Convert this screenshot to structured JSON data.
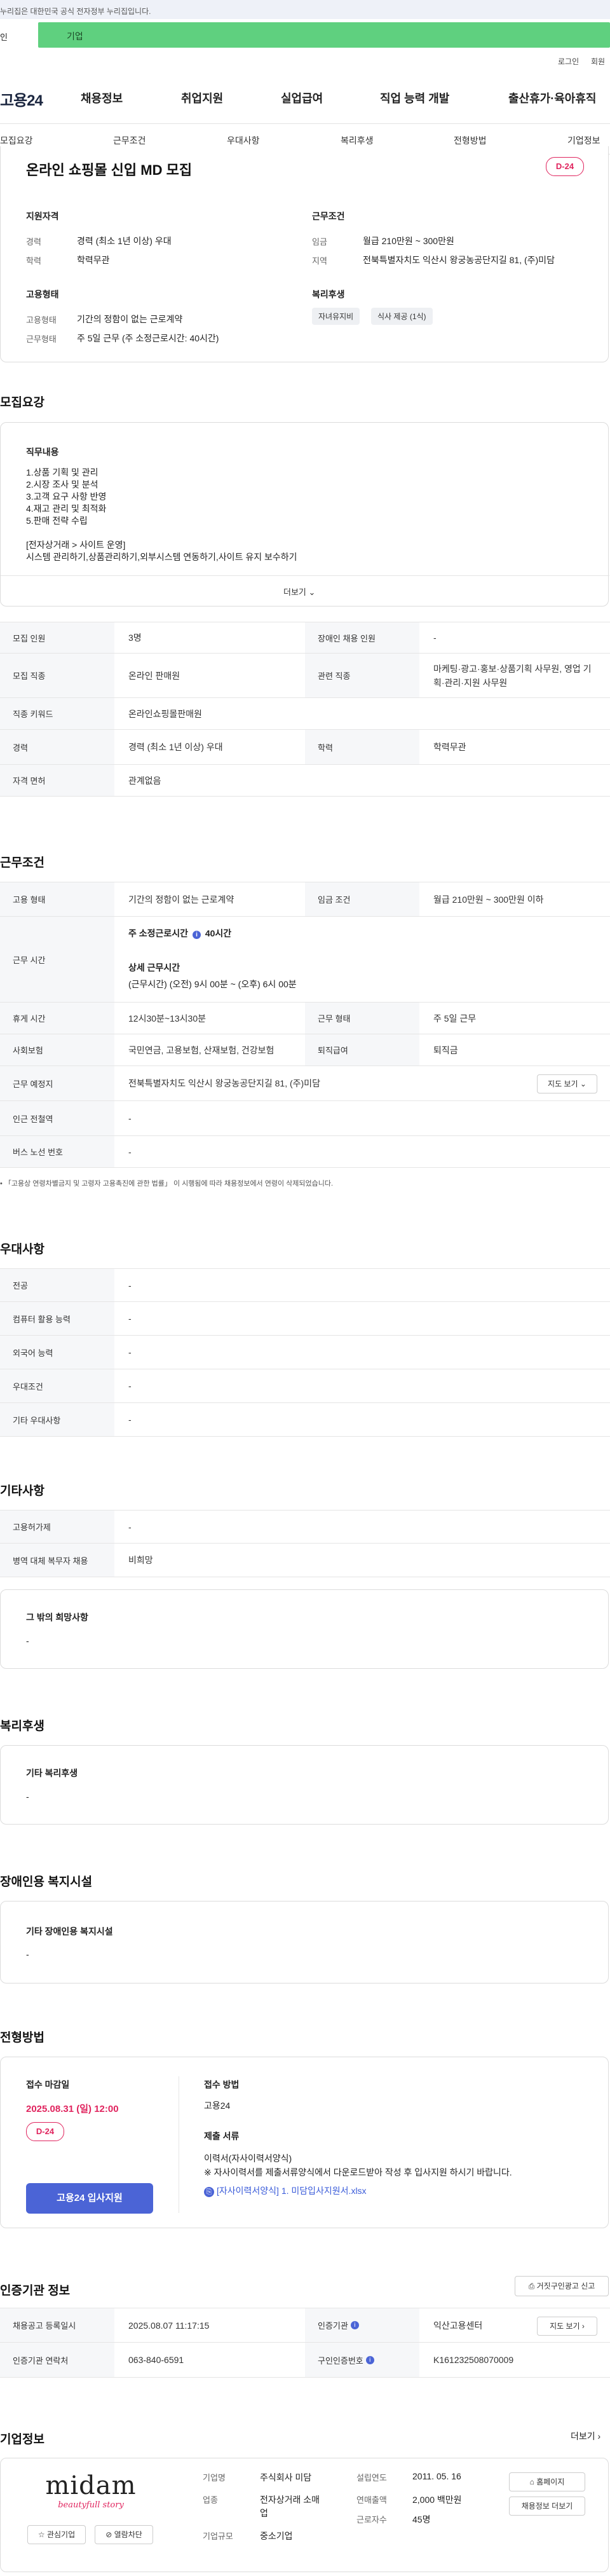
{
  "topbar": {
    "notice": "누리집은 대한민국 공식 전자정부 누리집입니다."
  },
  "env": {
    "left": "인",
    "right": "기업"
  },
  "util": {
    "login": "로그인",
    "join": "회원"
  },
  "logo": "고용24",
  "gnb": [
    "채용정보",
    "취업지원",
    "실업급여",
    "직업 능력 개발",
    "출산휴가·육아휴직"
  ],
  "subnav": [
    "모집요강",
    "근무조건",
    "우대사항",
    "복리후생",
    "전형방법",
    "기업정보"
  ],
  "summary": {
    "title": "온라인 쇼핑몰 신입 MD 모집",
    "dday": "D-24",
    "qual_title": "지원자격",
    "career_label": "경력",
    "career": "경력 (최소 1년 이상) 우대",
    "edu_label": "학력",
    "edu": "학력무관",
    "cond_title": "근무조건",
    "wage_label": "임금",
    "wage": "월급 210만원 ~ 300만원",
    "region_label": "지역",
    "region": "전북특별자치도 익산시 왕궁농공단지길 81, (주)미담",
    "emp_title": "고용형태",
    "emptype_label": "고용형태",
    "emptype": "기간의 정함이 없는 근로계약",
    "worktype_label": "근무형태",
    "worktype": "주 5일 근무 (주 소정근로시간: 40시간)",
    "welfare_title": "복리후생",
    "chips": [
      "자녀유지비",
      "식사 제공 (1식)"
    ]
  },
  "recruit": {
    "section_title": "모집요강",
    "duty_title": "직무내용",
    "duty_lines": [
      "1.상품 기획 및 관리",
      "2.시장 조사 및 분석",
      "3.고객 요구 사항 반영",
      "4.재고 관리 및 최적화",
      "5.판매 전략 수립"
    ],
    "duty_extra1": "[전자상거래 > 사이트 운영]",
    "duty_extra2": "시스템 관리하기,상품관리하기,외부시스템 연동하기,사이트 유지 보수하기",
    "more": "더보기",
    "rows": [
      {
        "l1": "모집 인원",
        "v1": "3명",
        "l2": "장애인 채용 인원",
        "v2": "-"
      },
      {
        "l1": "모집 직종",
        "v1": "온라인 판매원",
        "l2": "관련 직종",
        "v2a": "마케팅·광고·홍보·상품기획 사무원, 영업 기",
        "v2b": "획·관리·지원 사무원"
      },
      {
        "l1": "직종 키워드",
        "v1": "온라인쇼핑몰판매원"
      },
      {
        "l1": "경력",
        "v1": "경력 (최소 1년 이상) 우대",
        "l2": "학력",
        "v2": "학력무관"
      },
      {
        "l1": "자격 면허",
        "v1": "관계없음"
      }
    ]
  },
  "work": {
    "section_title": "근무조건",
    "emp_label": "고용 형태",
    "emp": "기간의 정함이 없는 근로계약",
    "wage_label": "임금 조건",
    "wage": "월급 210만원 ~ 300만원 이하",
    "hours_label": "근무 시간",
    "hours_week": "주 소정근로시간",
    "hours_value": "40시간",
    "hours_detail_title": "상세 근무시간",
    "hours_detail": "(근무시간) (오전) 9시 00분 ~ (오후) 6시 00분",
    "break_label": "휴게 시간",
    "break": "12시30분~13시30분",
    "form_label": "근무 형태",
    "form": "주 5일 근무",
    "ins_label": "사회보험",
    "ins": "국민연금, 고용보험, 산재보험, 건강보험",
    "retire_label": "퇴직급여",
    "retire": "퇴직금",
    "place_label": "근무 예정지",
    "place": "전북특별자치도 익산시 왕궁농공단지길 81, (주)미담",
    "map_btn": "지도 보기",
    "station_label": "인근 전철역",
    "station": "-",
    "bus_label": "버스 노선 번호",
    "bus": "-",
    "note": "「고용상 연령차별금지 및 고령자 고용촉진에 관한 법률」 이 시행됨에 따라 채용정보에서 연령이 삭제되었습니다."
  },
  "pref": {
    "section_title": "우대사항",
    "rows": [
      {
        "l": "전공",
        "v": "-"
      },
      {
        "l": "컴퓨터 활용 능력",
        "v": "-"
      },
      {
        "l": "외국어 능력",
        "v": "-"
      },
      {
        "l": "우대조건",
        "v": "-"
      },
      {
        "l": "기타 우대사항",
        "v": "-"
      }
    ]
  },
  "etc": {
    "section_title": "기타사항",
    "rows": [
      {
        "l": "고용허가제",
        "v": "-"
      },
      {
        "l": "병역 대체 복무자 채용",
        "v": "비희망"
      }
    ],
    "box_title": "그 밖의 희망사항",
    "box_value": "-"
  },
  "welfare": {
    "section_title": "복리후생",
    "box_title": "기타 복리후생",
    "box_value": "-"
  },
  "disability": {
    "section_title": "장애인용 복지시설",
    "box_title": "기타 장애인용 복지시설",
    "box_value": "-"
  },
  "process": {
    "section_title": "전형방법",
    "deadline_title": "접수 마감일",
    "deadline": "2025.08.31 (일) 12:00",
    "dday": "D-24",
    "apply_btn": "고용24 입사지원",
    "method_title": "접수 방법",
    "method": "고용24",
    "docs_title": "제출 서류",
    "docs1": "이력서(자사이력서양식)",
    "docs2": "※ 자사이력서를 제출서류양식에서 다운로드받아 작성 후 입사지원 하시기 바랍니다.",
    "file": "[자사이력서양식] 1. 미담입사지원서.xlsx"
  },
  "agency": {
    "section_title": "인증기관 정보",
    "report_btn": "거짓구인광고 신고",
    "reg_label": "채용공고 등록일시",
    "reg": "2025.08.07 11:17:15",
    "org_label": "인증기관",
    "org": "익산고용센터",
    "map_btn": "지도 보기",
    "contact_label": "인증기관 연락처",
    "contact": "063-840-6591",
    "id_label": "구인인증번호",
    "id": "K161232508070009"
  },
  "company": {
    "section_title": "기업정보",
    "more": "더보기",
    "logo_text": "midam",
    "logo_sub": "beautyfull story",
    "fav_btn": "관심기업",
    "block_btn": "열람차단",
    "name_label": "기업명",
    "name": "주식회사 미담",
    "ind_label": "업종",
    "ind1": "전자상거래 소매",
    "ind2": "업",
    "size_label": "기업규모",
    "size": "중소기업",
    "year_label": "설립연도",
    "year": "2011. 05. 16",
    "sales_label": "연매출액",
    "sales": "2,000 백만원",
    "emp_label": "근로자수",
    "emp": "45명",
    "home_btn": "홈페이지",
    "recruit_btn": "채용정보 더보기"
  },
  "colors": {
    "accent": "#e0245e",
    "primary": "#4b64d6",
    "env_green": "#5fd07f"
  }
}
